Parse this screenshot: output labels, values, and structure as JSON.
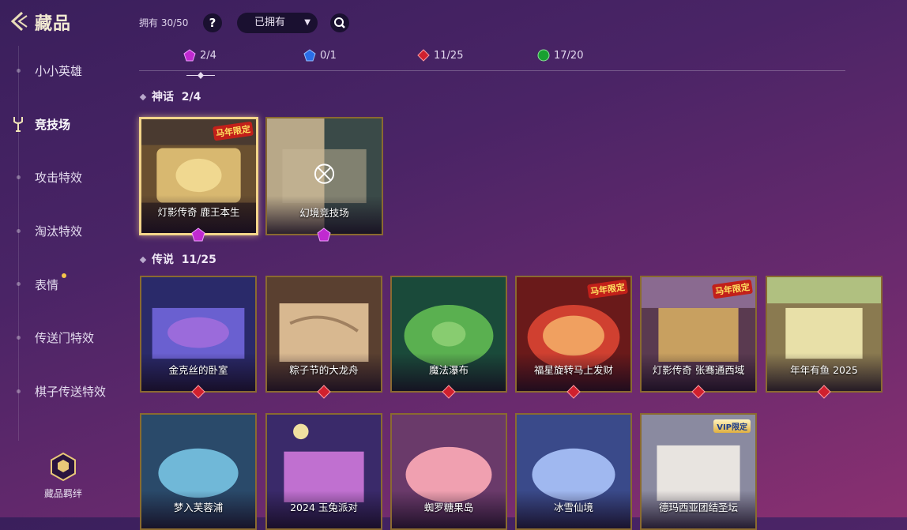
{
  "header": {
    "title": "藏品",
    "owned_text": "拥有 30/50",
    "help_label": "?",
    "filter_value": "已拥有"
  },
  "sidebar": {
    "items": [
      {
        "label": "小小英雄"
      },
      {
        "label": "竞技场"
      },
      {
        "label": "攻击特效"
      },
      {
        "label": "淘汰特效"
      },
      {
        "label": "表情"
      },
      {
        "label": "传送门特效"
      },
      {
        "label": "棋子传送特效"
      }
    ],
    "bonds_label": "藏品羁绊"
  },
  "rarity_tabs": [
    {
      "count": "2/4",
      "gem_color": "#c02ad0"
    },
    {
      "count": "0/1",
      "gem_color": "#2a6ee8"
    },
    {
      "count": "11/25",
      "gem_color": "#d0202e"
    },
    {
      "count": "17/20",
      "gem_color": "#18a030"
    }
  ],
  "sections": {
    "mythic": {
      "title": "神话",
      "count": "2/4"
    },
    "legendary": {
      "title": "传说",
      "count": "11/25"
    }
  },
  "mythic_cards": [
    {
      "name": "灯影传奇 鹿王本生",
      "tag": "马年限定",
      "selected": true
    },
    {
      "name": "幻境竞技场"
    }
  ],
  "legendary_cards": [
    {
      "name": "金克丝的卧室"
    },
    {
      "name": "粽子节的大龙舟"
    },
    {
      "name": "魔法瀑布"
    },
    {
      "name": "福星旋转马上发财",
      "tag": "马年限定"
    },
    {
      "name": "灯影传奇 张骞通西域",
      "tag": "马年限定"
    },
    {
      "name": "年年有鱼 2025"
    },
    {
      "name": "梦入芙蓉浦"
    },
    {
      "name": "2024 玉兔派对"
    },
    {
      "name": "蜘罗糖果岛"
    },
    {
      "name": "冰雪仙境"
    },
    {
      "name": "德玛西亚团结圣坛",
      "tag": "VIP限定"
    }
  ],
  "colors": {
    "gold_border": "#8a6a30",
    "selected_border": "#f3d58a",
    "mythic_gem": "#c02ad0",
    "legendary_gem": "#d0202e"
  }
}
